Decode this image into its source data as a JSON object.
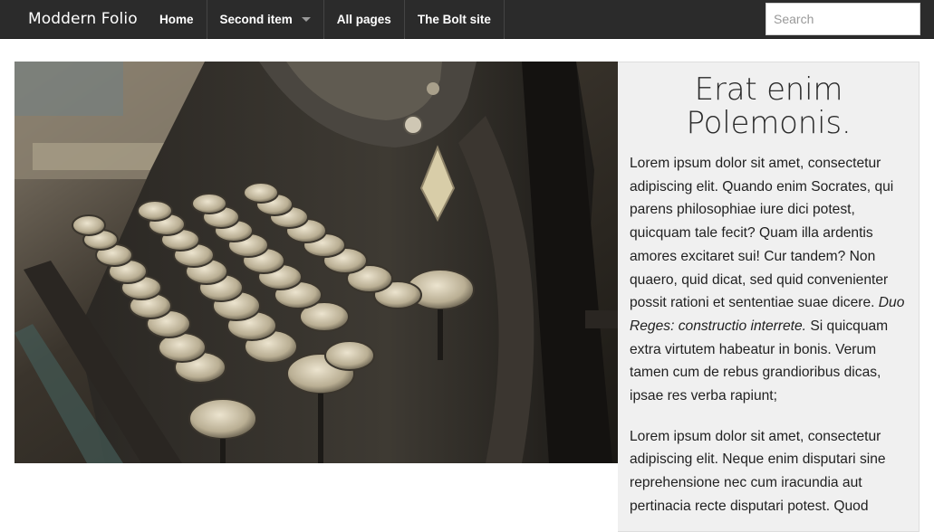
{
  "navbar": {
    "brand": "Moddern Folio",
    "items": [
      {
        "label": "Home"
      },
      {
        "label": "Second item"
      },
      {
        "label": "All pages"
      },
      {
        "label": "The Bolt site"
      }
    ],
    "search_placeholder": "Search"
  },
  "article": {
    "title": "Erat enim Polemonis.",
    "paragraph1_a": "Lorem ipsum dolor sit amet, consectetur adipiscing elit. Quando enim Socrates, qui parens philosophiae iure dici potest, quicquam tale fecit? Quam illa ardentis amores excitaret sui! Cur tandem? Non quaero, quid dicat, sed quid convenienter possit rationi et sententiae suae dicere. ",
    "paragraph1_em": "Duo Reges: constructio interrete.",
    "paragraph1_b": " Si quicquam extra virtutem habeatur in bonis. Verum tamen cum de rebus grandioribus dicas, ipsae res verba rapiunt;",
    "paragraph2": "Lorem ipsum dolor sit amet, consectetur adipiscing elit. Neque enim disputari sine reprehensione nec cum iracundia aut pertinacia recte disputari potest. Quod"
  },
  "colors": {
    "navbar_bg": "#2b2b2b",
    "panel_bg": "#f0f0f0"
  },
  "icons": {
    "dropdown": "chevron-down-icon"
  }
}
